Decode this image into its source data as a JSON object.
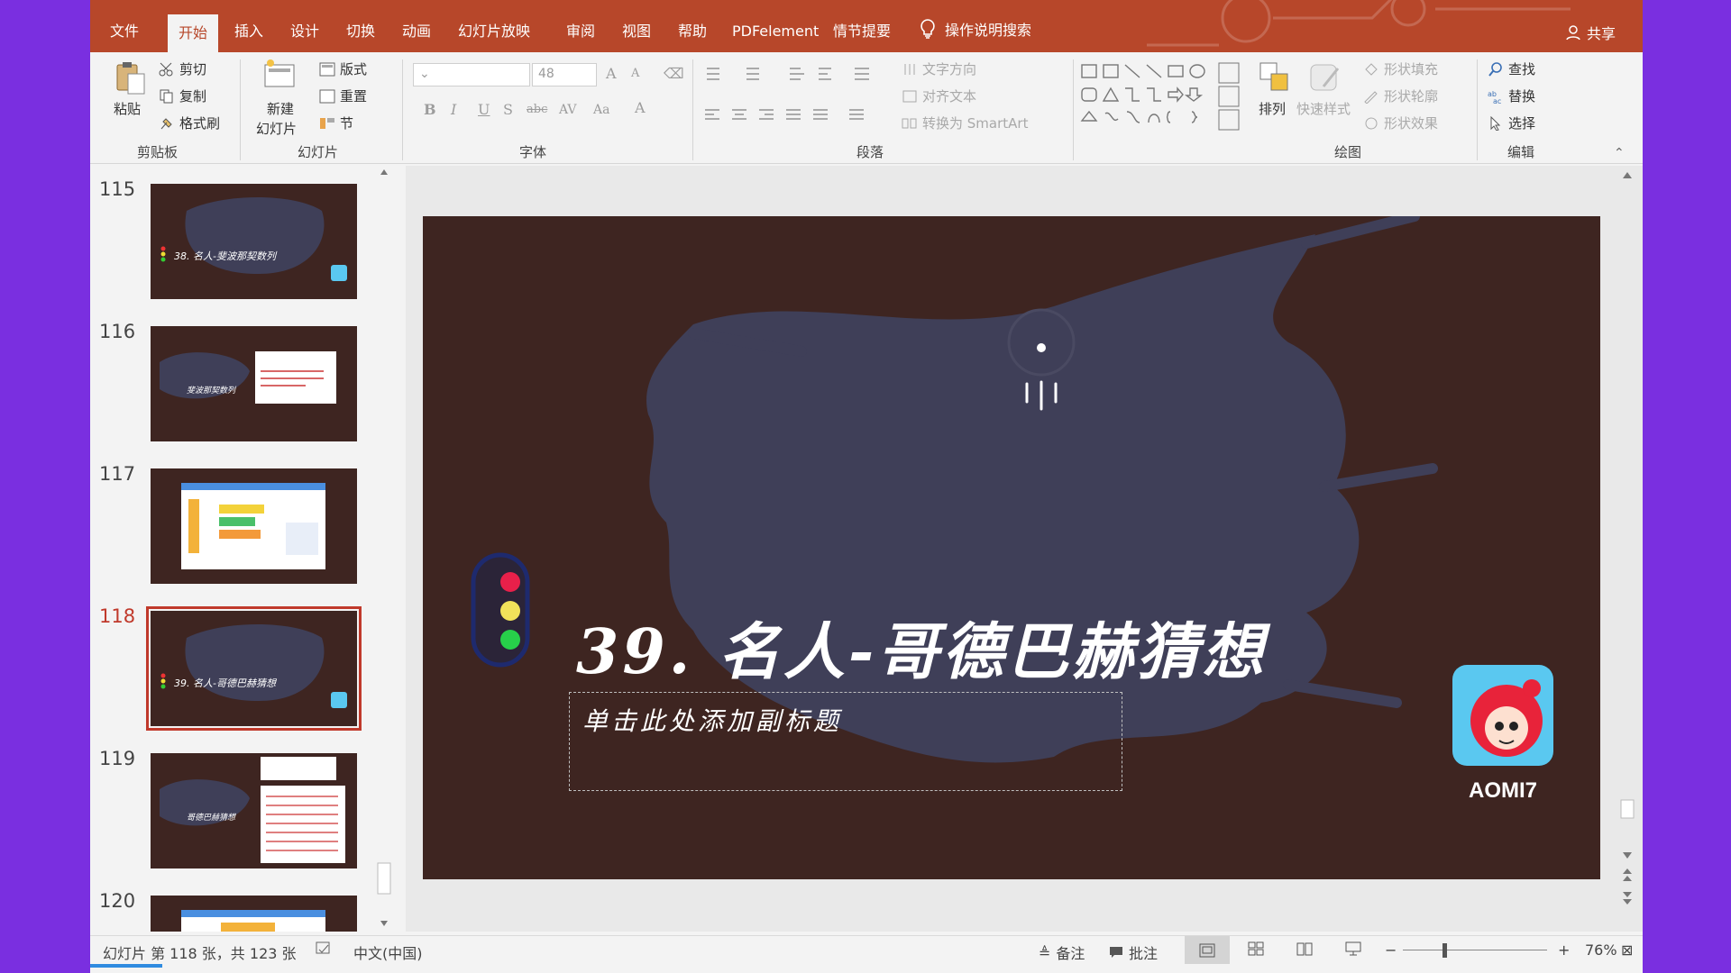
{
  "ribbon_tabs": [
    {
      "label": "文件",
      "active": false
    },
    {
      "label": "开始",
      "active": true
    },
    {
      "label": "插入",
      "active": false
    },
    {
      "label": "设计",
      "active": false
    },
    {
      "label": "切换",
      "active": false
    },
    {
      "label": "动画",
      "active": false
    },
    {
      "label": "幻灯片放映",
      "active": false
    },
    {
      "label": "审阅",
      "active": false
    },
    {
      "label": "视图",
      "active": false
    },
    {
      "label": "帮助",
      "active": false
    },
    {
      "label": "PDFelement",
      "active": false
    },
    {
      "label": "情节提要",
      "active": false
    }
  ],
  "tell_me": "操作说明搜索",
  "share": "共享",
  "clipboard": {
    "paste": "粘贴",
    "cut": "剪切",
    "copy": "复制",
    "format_painter": "格式刷",
    "label": "剪贴板"
  },
  "slides_group": {
    "new_slide_1": "新建",
    "new_slide_2": "幻灯片",
    "layout": "版式",
    "reset": "重置",
    "section": "节",
    "label": "幻灯片"
  },
  "font_group": {
    "font_size": "48",
    "label": "字体",
    "buttons": [
      "B",
      "I",
      "U",
      "S",
      "abc",
      "AV",
      "Aa",
      "A"
    ]
  },
  "paragraph_group": {
    "text_direction": "文字方向",
    "align_text": "对齐文本",
    "convert_smartart": "转换为 SmartArt",
    "label": "段落"
  },
  "drawing_group": {
    "arrange": "排列",
    "quick_styles": "快速样式",
    "shape_fill": "形状填充",
    "shape_outline": "形状轮廓",
    "shape_effects": "形状效果",
    "label": "绘图"
  },
  "editing_group": {
    "find": "查找",
    "replace": "替换",
    "select": "选择",
    "label": "编辑"
  },
  "thumbnails": [
    {
      "num": "115",
      "selected": false,
      "caption": "38. 名人-斐波那契数列"
    },
    {
      "num": "116",
      "selected": false,
      "caption": "斐波那契数列"
    },
    {
      "num": "117",
      "selected": false,
      "caption": ""
    },
    {
      "num": "118",
      "selected": true,
      "caption": "39. 名人-哥德巴赫猜想"
    },
    {
      "num": "119",
      "selected": false,
      "caption": "哥德巴赫猜想"
    },
    {
      "num": "120",
      "selected": false,
      "caption": ""
    }
  ],
  "slide": {
    "title": "39. 名人-哥德巴赫猜想",
    "subtitle_placeholder": "单击此处添加副标题",
    "logo_text": "AOMI7"
  },
  "status": {
    "slide_count": "幻灯片 第 118 张，共 123 张",
    "language": "中文(中国)",
    "notes": "备注",
    "comments": "批注",
    "zoom": "76%",
    "zoom_level_percent": 76
  },
  "colors": {
    "accent": "#b7472a",
    "slide_bg": "#3e2521",
    "brush": "#3f3f58",
    "selected": "#c0392b",
    "window_bg": "#7a2fe0"
  }
}
